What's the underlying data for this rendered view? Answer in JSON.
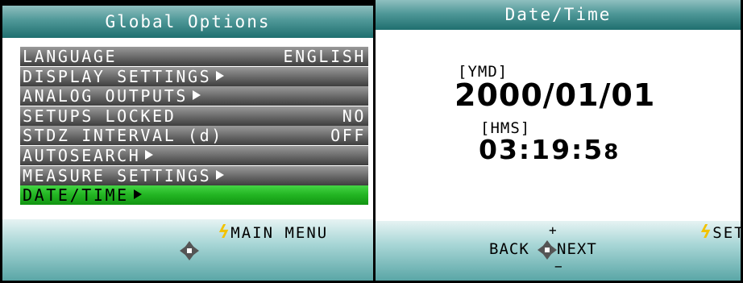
{
  "global_options": {
    "title": "Global Options",
    "menu": [
      {
        "label": "LANGUAGE",
        "value": "ENGLISH",
        "submenu": false,
        "selected": false
      },
      {
        "label": "DISPLAY SETTINGS",
        "value": "",
        "submenu": true,
        "selected": false
      },
      {
        "label": "ANALOG OUTPUTS",
        "value": "",
        "submenu": true,
        "selected": false
      },
      {
        "label": "SETUPS LOCKED",
        "value": "NO",
        "submenu": false,
        "selected": false
      },
      {
        "label": "STDZ INTERVAL (d)",
        "value": "OFF",
        "submenu": false,
        "selected": false
      },
      {
        "label": "AUTOSEARCH",
        "value": "",
        "submenu": true,
        "selected": false
      },
      {
        "label": "MEASURE SETTINGS",
        "value": "",
        "submenu": true,
        "selected": false
      },
      {
        "label": "DATE/TIME",
        "value": "",
        "submenu": true,
        "selected": true
      }
    ],
    "footer": {
      "softkey_label": "MAIN MENU",
      "softkey_icon": "lightning-bolt-icon"
    }
  },
  "date_time": {
    "title": "Date/Time",
    "date_label": "[YMD]",
    "date_value": "2000/01/01",
    "time_label": "[HMS]",
    "time_value": "03:19:5",
    "time_last_digit_glitch": "8",
    "footer": {
      "softkey_label": "SET",
      "softkey_icon": "lightning-bolt-icon",
      "plus_label": "+",
      "minus_label": "−",
      "back_label": "BACK",
      "next_label": "NEXT"
    }
  },
  "colors": {
    "title_gradient": [
      "#8fbfbf",
      "#1f6f6f"
    ],
    "menu_item": "#6c6c6c",
    "menu_selected": "#22b422",
    "footer_gradient": [
      "#e6f3f3",
      "#5aa6a6"
    ],
    "bolt": "#f2c200"
  }
}
